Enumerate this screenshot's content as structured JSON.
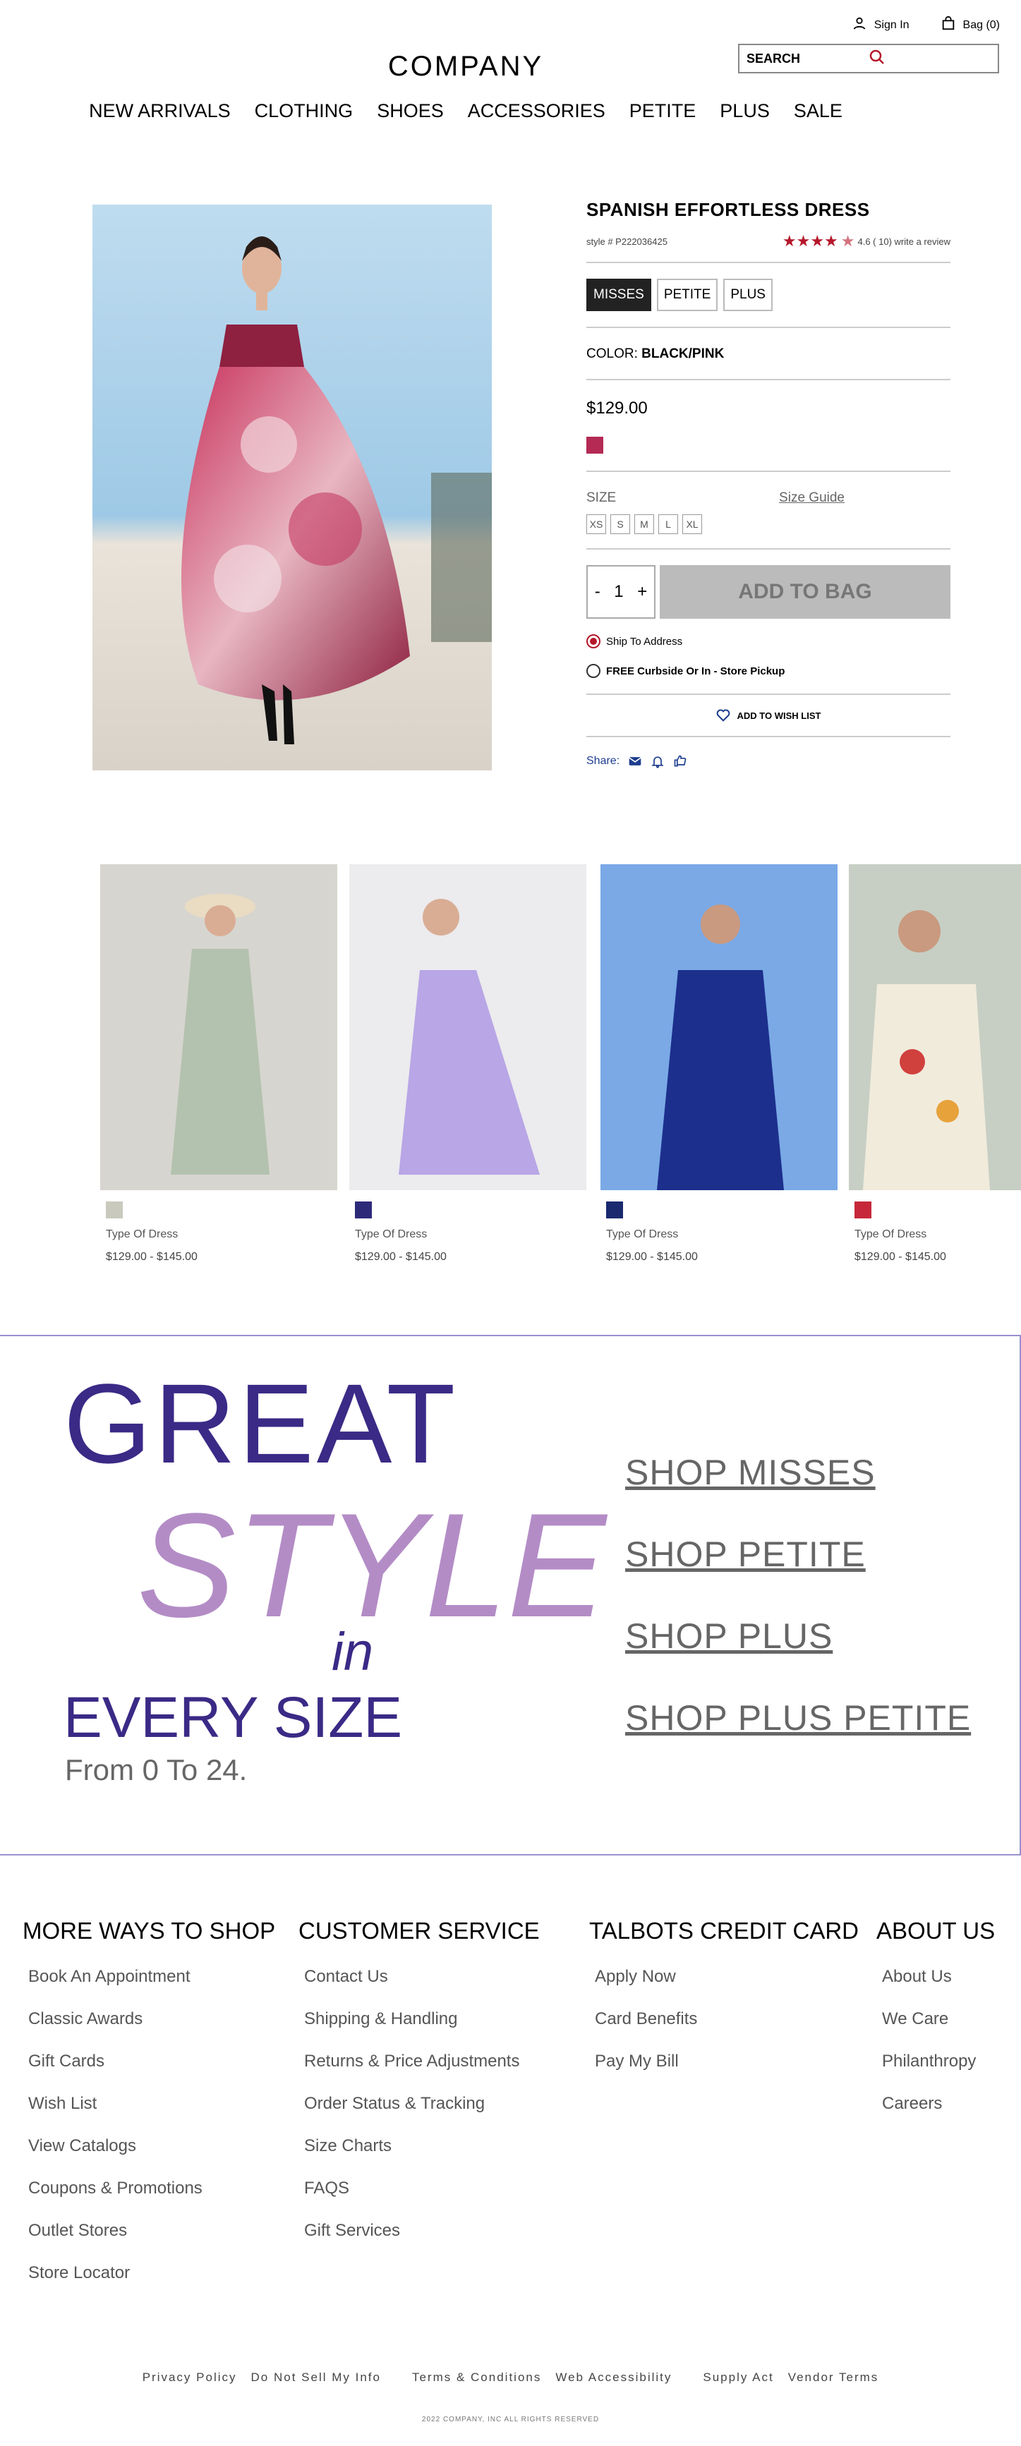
{
  "header": {
    "sign_in": "Sign In",
    "bag": "Bag (0)",
    "logo": "COMPANY",
    "search_placeholder": "SEARCH"
  },
  "nav": [
    "NEW ARRIVALS",
    "CLOTHING",
    "SHOES",
    "ACCESSORIES",
    "PETITE",
    "PLUS",
    "SALE"
  ],
  "product": {
    "title": "SPANISH EFFORTLESS DRESS",
    "style": "style # P222036425",
    "rating": "4.6 ( 10) write a review",
    "rating_value": 4.6,
    "size_tabs": [
      "MISSES",
      "PETITE",
      "PLUS"
    ],
    "color_label": "COLOR:",
    "color_value": "BLACK/PINK",
    "price": "$129.00",
    "swatch_color": "#b42a55",
    "size_label": "SIZE",
    "size_guide": "Size Guide",
    "sizes": [
      "XS",
      "S",
      "M",
      "L",
      "XL"
    ],
    "qty_minus": "-",
    "qty": "1",
    "qty_plus": "+",
    "add_to_bag": "ADD TO BAG",
    "ship": "Ship To Address",
    "pickup": "FREE Curbside Or In - Store Pickup",
    "wish": "ADD TO WISH LIST",
    "share": "Share:"
  },
  "recommended": [
    {
      "name": "Type Of Dress",
      "price": "$129.00 - $145.00",
      "swatch": "#c9c9bd"
    },
    {
      "name": "Type Of Dress",
      "price": "$129.00 - $145.00",
      "swatch": "#2e2a7a"
    },
    {
      "name": "Type Of Dress",
      "price": "$129.00 - $145.00",
      "swatch": "#1b2a6e"
    },
    {
      "name": "Type Of Dress",
      "price": "$129.00 - $145.00",
      "swatch": "#c6283a"
    }
  ],
  "promo": {
    "great": "GREAT",
    "style": "STYLE",
    "in": "in",
    "every": "EVERY SIZE",
    "from": "From 0 To 24.",
    "links": [
      "SHOP MISSES",
      "SHOP PETITE",
      "SHOP PLUS",
      "SHOP PLUS PETITE"
    ]
  },
  "footer": {
    "columns": [
      {
        "title": "MORE WAYS TO SHOP",
        "links": [
          "Book An Appointment",
          "Classic Awards",
          "Gift Cards",
          "Wish List",
          "View Catalogs",
          "Coupons & Promotions",
          "Outlet Stores",
          "Store Locator"
        ]
      },
      {
        "title": "CUSTOMER SERVICE",
        "links": [
          "Contact Us",
          "Shipping & Handling",
          "Returns & Price Adjustments",
          "Order Status & Tracking",
          "Size Charts",
          "FAQS",
          "Gift Services"
        ]
      },
      {
        "title": "TALBOTS CREDIT CARD",
        "links": [
          "Apply Now",
          "Card Benefits",
          "Pay My Bill"
        ]
      },
      {
        "title": "ABOUT US",
        "links": [
          "About Us",
          "We Care",
          "Philanthropy",
          "Careers"
        ]
      }
    ],
    "legal": [
      "Privacy Policy",
      "Do Not Sell My Info",
      "Terms & Conditions",
      "Web Accessibility",
      "Supply Act",
      "Vendor Terms"
    ],
    "copyright": "2022 COMPANY, INC ALL RIGHTS RESERVED"
  },
  "colors": {
    "accent": "#b5172a",
    "promo_purple": "#3b2a86",
    "promo_lilac": "#b38cc6"
  }
}
